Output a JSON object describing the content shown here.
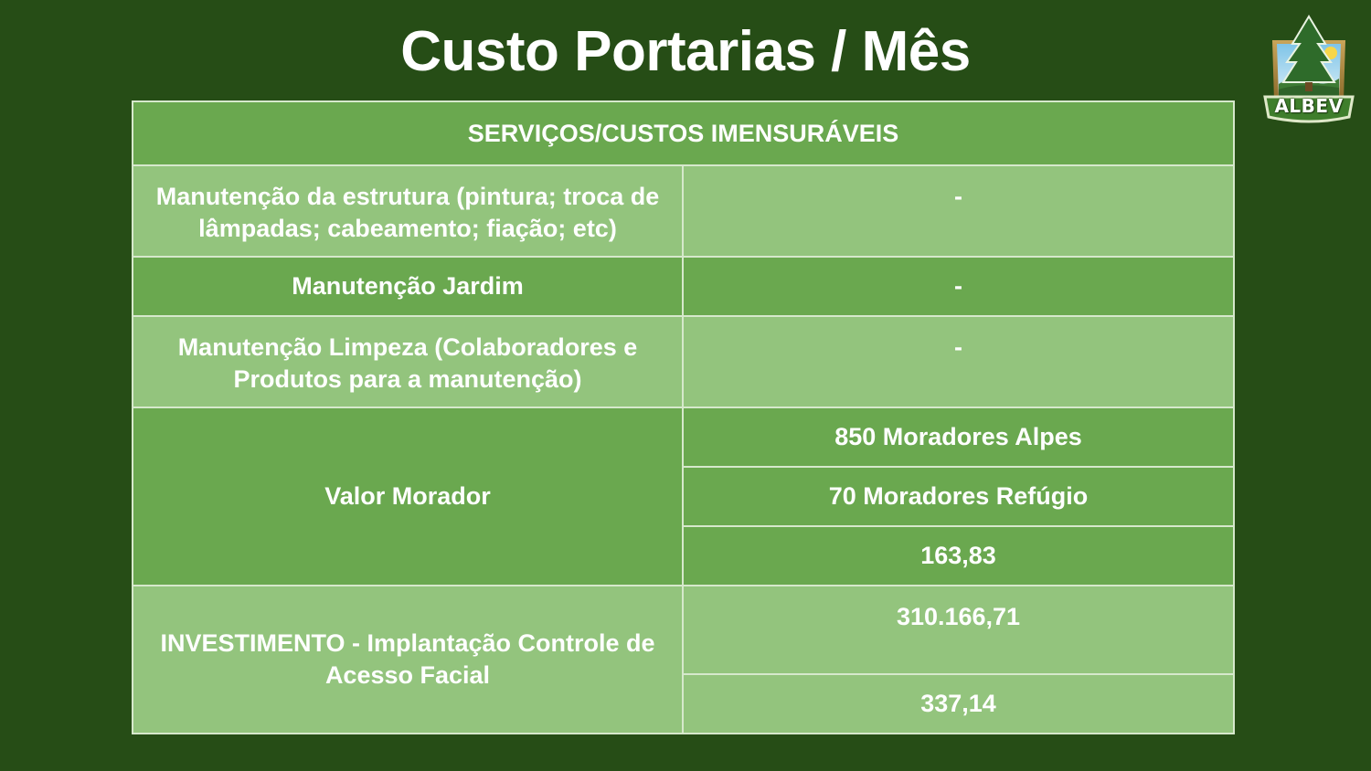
{
  "title": "Custo Portarias / Mês",
  "logo": {
    "text": "ALBEV",
    "icon": "pine-tree-badge-icon"
  },
  "table": {
    "header": "SERVIÇOS/CUSTOS IMENSURÁVEIS",
    "rows": [
      {
        "label": "Manutenção da estrutura (pintura; troca de lâmpadas; cabeamento; fiação; etc)",
        "value": "-"
      },
      {
        "label": "Manutenção Jardim",
        "value": "-"
      },
      {
        "label": "Manutenção Limpeza (Colaboradores e Produtos para a manutenção)",
        "value": "-"
      }
    ],
    "valor_morador": {
      "label": "Valor Morador",
      "values": [
        "850 Moradores Alpes",
        "70 Moradores Refúgio",
        "163,83"
      ]
    },
    "investimento": {
      "label": "INVESTIMENTO - Implantação Controle de Acesso Facial",
      "values": [
        "310.166,71",
        "337,14"
      ]
    }
  },
  "colors": {
    "background": "#264d16",
    "row_dark": "#6aa84f",
    "row_light": "#93c47d",
    "border": "#d6e8cc"
  }
}
